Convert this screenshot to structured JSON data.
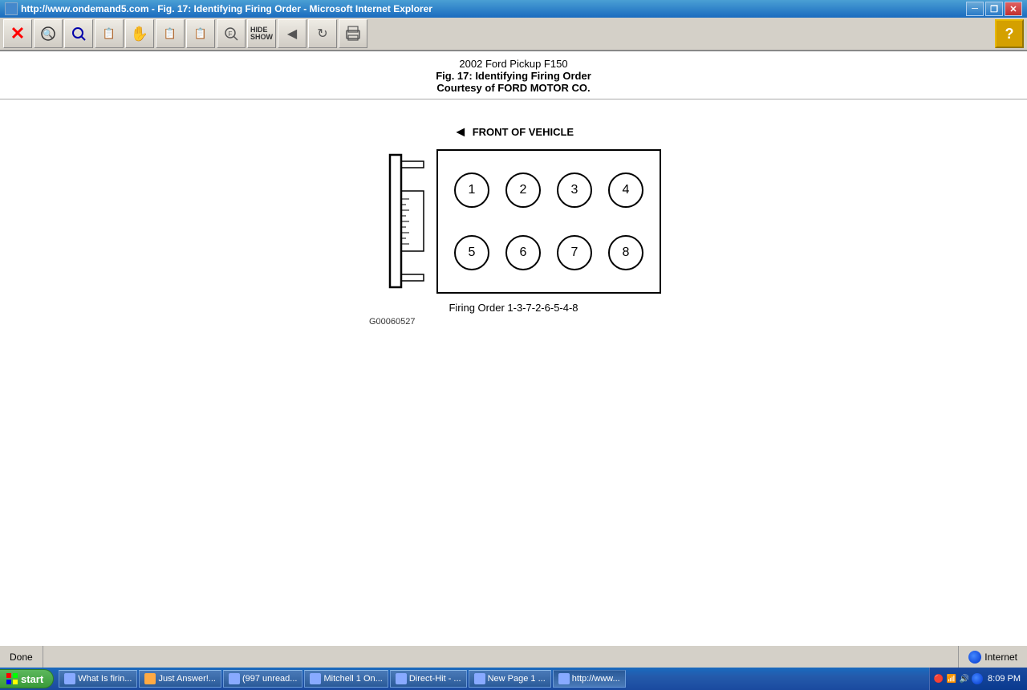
{
  "titlebar": {
    "title": "http://www.ondemand5.com - Fig. 17: Identifying Firing Order - Microsoft Internet Explorer",
    "buttons": {
      "minimize": "─",
      "restore": "❐",
      "close": "✕"
    }
  },
  "toolbar": {
    "buttons": [
      {
        "name": "close-btn",
        "icon": "✕",
        "color": "red"
      },
      {
        "name": "back-btn",
        "icon": "⬛"
      },
      {
        "name": "search-btn",
        "icon": "🔍"
      },
      {
        "name": "figure-btn",
        "icon": "📄"
      },
      {
        "name": "hand-btn",
        "icon": "✋"
      },
      {
        "name": "fig2-btn",
        "icon": "📄"
      },
      {
        "name": "fig3-btn",
        "icon": "📄"
      },
      {
        "name": "find-btn",
        "icon": "🔎"
      },
      {
        "name": "hide-show-btn",
        "icon": "HS"
      },
      {
        "name": "nav-btn",
        "icon": "◀▶"
      },
      {
        "name": "refresh-btn",
        "icon": "🔄"
      },
      {
        "name": "print-btn",
        "icon": "🖨"
      }
    ],
    "help_icon": "?"
  },
  "document": {
    "title1": "2002 Ford Pickup F150",
    "title2": "Fig. 17: Identifying Firing Order",
    "title3": "Courtesy of FORD MOTOR CO."
  },
  "diagram": {
    "front_label": "◄ FRONT OF VEHICLE",
    "cylinders": [
      "①",
      "②",
      "③",
      "④",
      "⑤",
      "⑥",
      "⑦",
      "⑧"
    ],
    "cylinder_numbers": [
      "1",
      "2",
      "3",
      "4",
      "5",
      "6",
      "7",
      "8"
    ],
    "firing_order_label": "Firing Order 1-3-7-2-6-5-4-8",
    "figure_code": "G00060527"
  },
  "statusbar": {
    "done": "Done",
    "zone": "Internet"
  },
  "taskbar": {
    "start": "start",
    "items": [
      {
        "label": "What Is firin...",
        "active": false
      },
      {
        "label": "Just Answer!...",
        "active": false
      },
      {
        "label": "(997 unread...",
        "active": false
      },
      {
        "label": "Mitchell 1 On...",
        "active": false
      },
      {
        "label": "Direct-Hit - ...",
        "active": false
      },
      {
        "label": "New Page 1 ...",
        "active": false
      },
      {
        "label": "http://www...",
        "active": true
      }
    ],
    "clock": "8:09 PM"
  }
}
